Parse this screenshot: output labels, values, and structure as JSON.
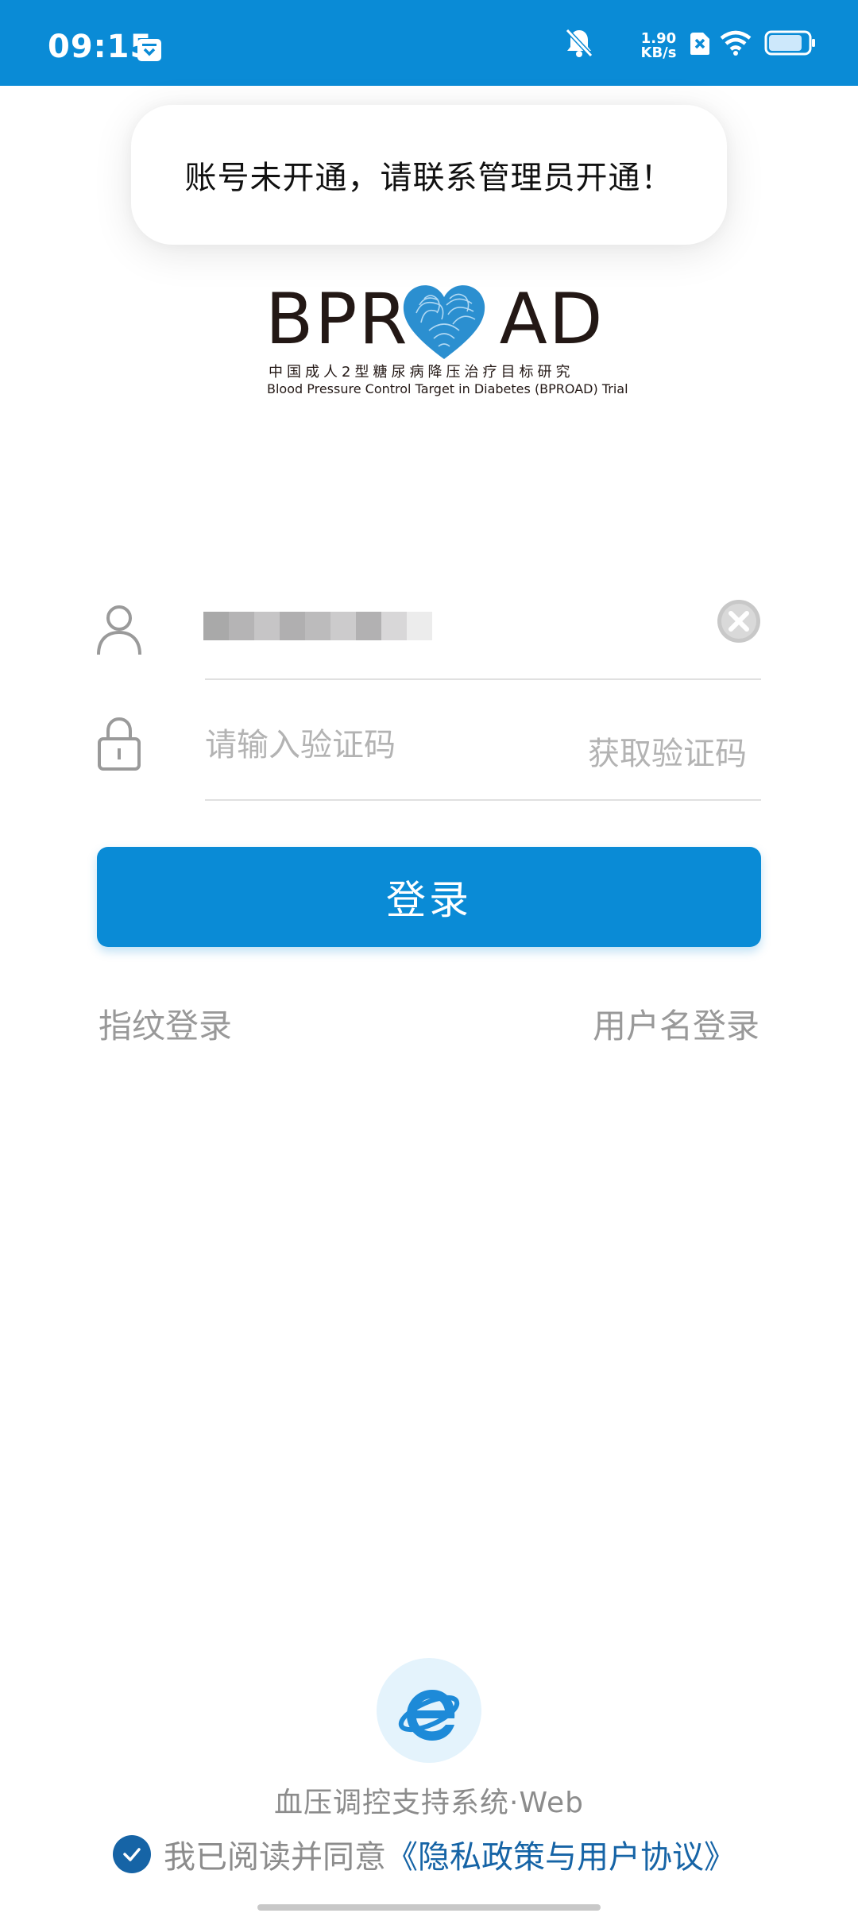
{
  "status_bar": {
    "time": "09:15",
    "net_speed_value": "1.90",
    "net_speed_unit": "KB/s",
    "icons": [
      "calendar-icon",
      "mute-bell-icon",
      "sim-x-icon",
      "wifi-icon",
      "battery-icon"
    ],
    "battery_level": 0.85
  },
  "toast": {
    "message": "账号未开通，请联系管理员开通！"
  },
  "logo": {
    "wordmark_left": "BPR",
    "wordmark_right": "AD",
    "subtitle_cn": "中国成人2型糖尿病降压治疗目标研究",
    "subtitle_en": "Blood Pressure Control Target in Diabetes (BPROAD) Trial"
  },
  "form": {
    "username_icon": "user-icon",
    "code_icon": "lock-icon",
    "code_placeholder": "请输入验证码",
    "get_code_label": "获取验证码",
    "login_label": "登录",
    "fingerprint_label": "指纹登录",
    "username_login_label": "用户名登录"
  },
  "footer": {
    "system_name": "血压调控支持系统·Web",
    "agree_text": "我已阅读并同意",
    "agree_link": "《隐私政策与用户协议》"
  },
  "colors": {
    "primary": "#0a8bd6",
    "link": "#1664a6",
    "muted": "#999999"
  }
}
